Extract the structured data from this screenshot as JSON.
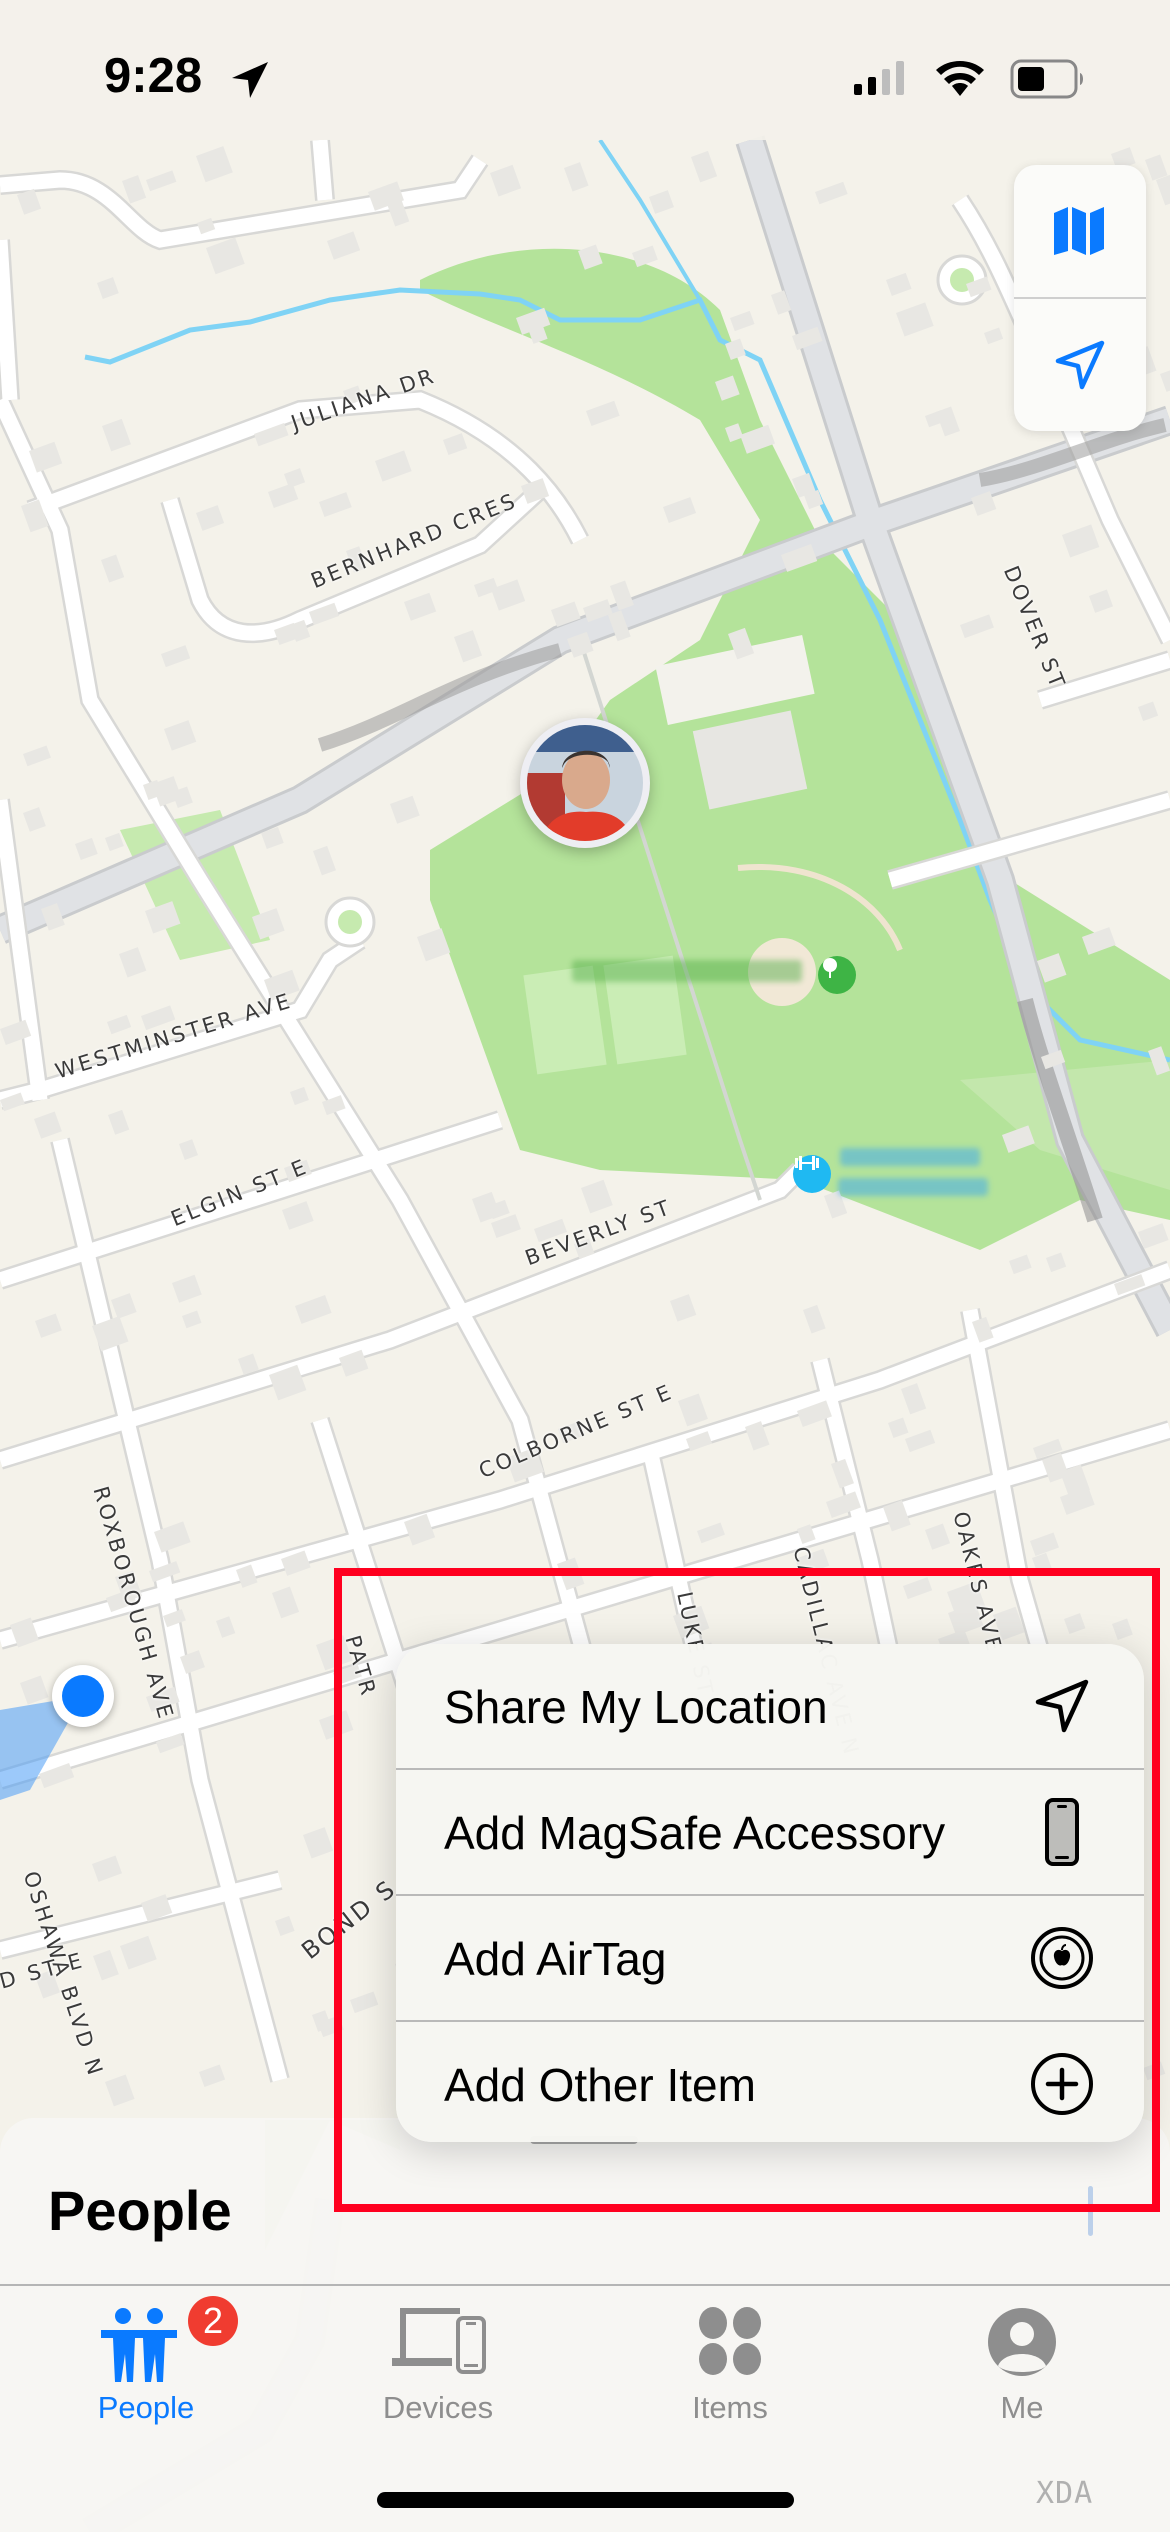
{
  "status_bar": {
    "time": "9:28",
    "location_icon": "location-arrow-icon",
    "signal_icon": "cellular-signal-icon",
    "wifi_icon": "wifi-icon",
    "battery_icon": "battery-icon"
  },
  "map": {
    "street_labels": [
      {
        "text": "JULIANA DR"
      },
      {
        "text": "BERNHARD CRES"
      },
      {
        "text": "DOVER ST"
      },
      {
        "text": "WESTMINSTER AVE"
      },
      {
        "text": "ELGIN ST E"
      },
      {
        "text": "BEVERLY ST"
      },
      {
        "text": "ROXBOROUGH AVE"
      },
      {
        "text": "COLBORNE ST E"
      },
      {
        "text": "LUKE ST"
      },
      {
        "text": "CADILLAC AVE N"
      },
      {
        "text": "OAKES AVE"
      },
      {
        "text": "PATR"
      },
      {
        "text": "OSHAWA BLVD N"
      },
      {
        "text": "BOND S"
      },
      {
        "text": "D ST E"
      },
      {
        "text": "VD N"
      }
    ],
    "park_pin_icon": "tree-icon",
    "gym_pin_icon": "dumbbell-icon",
    "person_marker": "person-avatar",
    "user_location": "blue-location-dot",
    "colors": {
      "land": "#f4f2ea",
      "park": "#b4e39a",
      "water": "#7fd3f5",
      "road": "#ffffff",
      "major_road": "#dfe1e4",
      "accent": "#0a7aff"
    }
  },
  "map_controls": {
    "map_mode_icon": "map-icon",
    "track_location_icon": "location-arrow-outline-icon"
  },
  "add_menu": {
    "items": [
      {
        "label": "Share My Location",
        "icon": "location-arrow-outline-icon"
      },
      {
        "label": "Add MagSafe Accessory",
        "icon": "iphone-icon"
      },
      {
        "label": "Add AirTag",
        "icon": "airtag-icon"
      },
      {
        "label": "Add Other Item",
        "icon": "plus-circle-icon"
      }
    ]
  },
  "sheet": {
    "title": "People"
  },
  "tab_bar": {
    "tabs": [
      {
        "label": "People",
        "icon": "people-icon",
        "active": true,
        "badge": "2"
      },
      {
        "label": "Devices",
        "icon": "devices-icon",
        "active": false
      },
      {
        "label": "Items",
        "icon": "items-icon",
        "active": false
      },
      {
        "label": "Me",
        "icon": "person-circle-icon",
        "active": false
      }
    ]
  },
  "watermark": "XDA"
}
